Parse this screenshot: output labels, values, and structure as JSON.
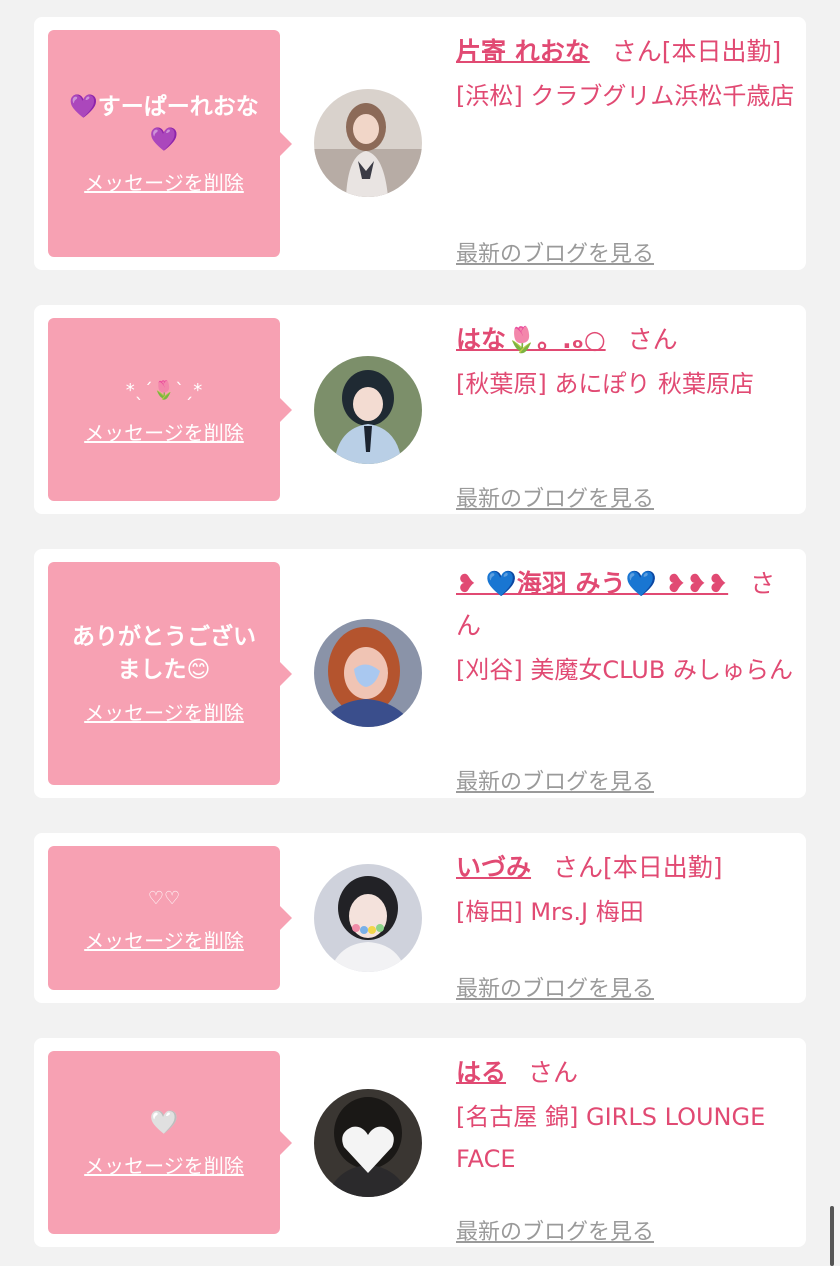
{
  "delete_label": "メッセージを削除",
  "blog_label": "最新のブログを見る",
  "san": "さん",
  "entries": [
    {
      "message": "💜すーぱーれおな\n💜",
      "name": "片寄 れおな",
      "status": "[本日出勤]",
      "shop": "[浜松] クラブグリム浜松千歳店",
      "avatar_icon": "person-photo-icon"
    },
    {
      "message": "*ˎˊ🌷ˋˏ*",
      "name": "はな🌷。.ₒ○",
      "status": "",
      "shop": "[秋葉原] あにぽり 秋葉原店",
      "avatar_icon": "person-photo-icon"
    },
    {
      "message": "ありがとうござい\nました😊",
      "name": "❥ 💙海羽 みう💙 ❥❥❥",
      "status": "",
      "shop": "[刈谷] 美魔女CLUB みしゅらん",
      "avatar_icon": "person-photo-icon"
    },
    {
      "message": "♡♡",
      "name": "いづみ",
      "status": "[本日出勤]",
      "shop": "[梅田] Mrs.J 梅田",
      "avatar_icon": "person-photo-icon"
    },
    {
      "message": "🤍",
      "name": "はる",
      "status": "",
      "shop": "[名古屋 錦] GIRLS LOUNGE FACE",
      "avatar_icon": "person-photo-icon"
    }
  ]
}
